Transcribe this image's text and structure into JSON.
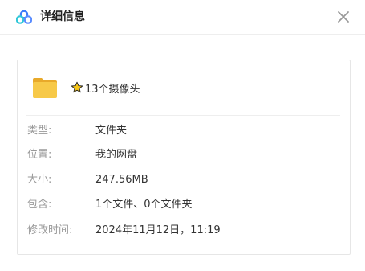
{
  "header": {
    "title": "详细信息",
    "logo_icon": "cloud-logo-icon",
    "close_icon": "close-icon"
  },
  "item": {
    "icon": "folder-icon",
    "starred_icon": "star-icon",
    "name": "13个摄像头"
  },
  "details": [
    {
      "label": "类型:",
      "value": "文件夹"
    },
    {
      "label": "位置:",
      "value": "我的网盘"
    },
    {
      "label": "大小:",
      "value": "247.56MB"
    },
    {
      "label": "包含:",
      "value": "1个文件、0个文件夹"
    },
    {
      "label": "修改时间:",
      "value": "2024年11月12日，11:19"
    }
  ],
  "colors": {
    "folder": "#f7c948",
    "star": "#f5c518",
    "logo_blue": "#3e7bfa",
    "logo_cyan": "#2fc7d8",
    "label": "#9a9a9a"
  }
}
